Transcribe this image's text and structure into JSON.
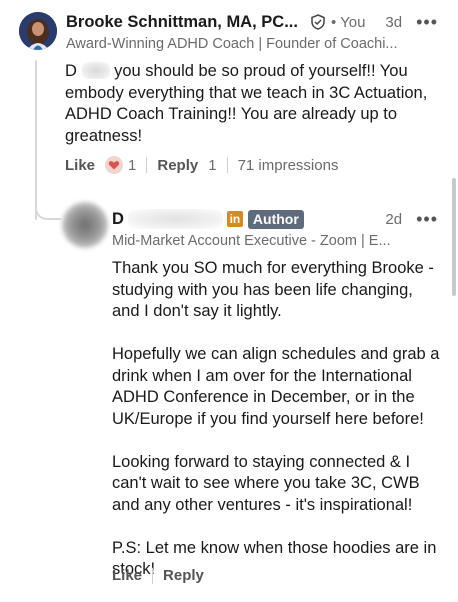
{
  "comment": {
    "author_name": "Brooke Schnittman, MA, PC...",
    "you_label": "• You",
    "time": "3d",
    "more_icon": "•••",
    "headline": "Award-Winning ADHD Coach | Founder of Coachi...",
    "text_start": "D",
    "text_rest": "you should be so proud of yourself!! You embody everything that we teach in 3C Actuation, ADHD Coach Training!! You are already up to greatness!",
    "like_label": "Like",
    "reaction_count": "1",
    "reply_label": "Reply",
    "reply_count": "1",
    "impressions": "71 impressions"
  },
  "reply": {
    "author_initial": "D",
    "linkedin_badge": "in",
    "author_badge": "Author",
    "time": "2d",
    "more_icon": "•••",
    "headline": "Mid-Market Account Executive - Zoom | E...",
    "paragraphs": [
      "Thank you SO much for everything Brooke - studying with you has been life changing, and I don't say it lightly.",
      "Hopefully we can align schedules and grab a drink when I am over for the International ADHD Conference in December, or in the UK/Europe if you find yourself here before!",
      "Looking forward to staying connected & I can't wait to see where you take 3C, CWB and any other ventures - it's inspirational!",
      "P.S: Let me know when those hoodies are in stock!"
    ],
    "like_label": "Like",
    "reply_label": "Reply"
  },
  "colors": {
    "reaction_heart": "#d9534f",
    "author_badge_bg": "#5e6b7d",
    "linkedin_badge_bg": "#d98a1e"
  }
}
